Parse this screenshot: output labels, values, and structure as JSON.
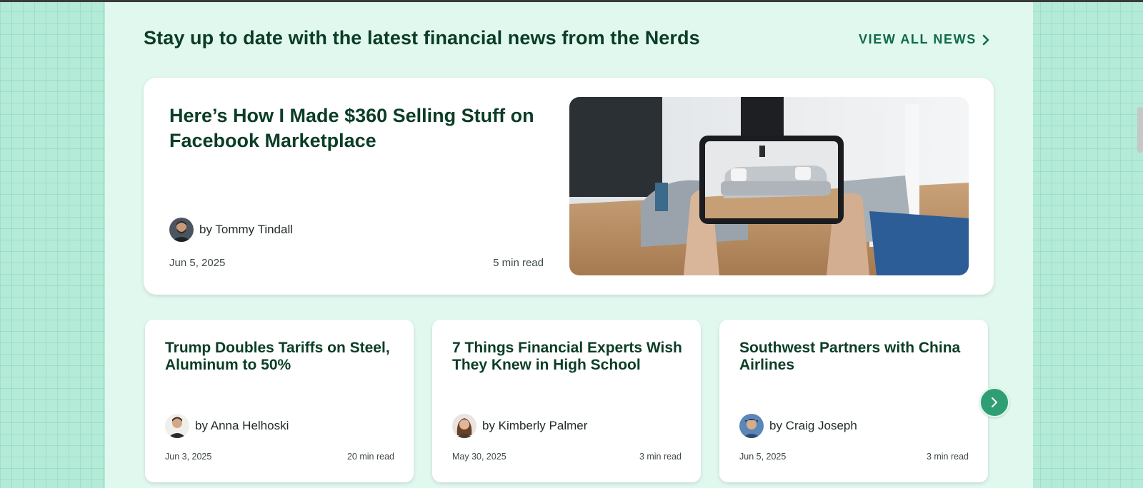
{
  "section": {
    "heading": "Stay up to date with the latest financial news from the Nerds",
    "view_all_label": "VIEW ALL NEWS"
  },
  "featured": {
    "title": "Here’s How I Made $360 Selling Stuff on Facebook Marketplace",
    "author": "by Tommy Tindall",
    "date": "Jun 5, 2025",
    "read_time": "5 min read"
  },
  "cards": [
    {
      "title": "Trump Doubles Tariffs on Steel, Aluminum to 50%",
      "author": "by Anna Helhoski",
      "date": "Jun 3, 2025",
      "read_time": "20 min read"
    },
    {
      "title": "7 Things Financial Experts Wish They Knew in High School",
      "author": "by Kimberly Palmer",
      "date": "May 30, 2025",
      "read_time": "3 min read"
    },
    {
      "title": "Southwest Partners with China Airlines",
      "author": "by Craig Joseph",
      "date": "Jun 5, 2025",
      "read_time": "3 min read"
    }
  ],
  "icons": {
    "view_all": "chevron-right-icon",
    "next": "chevron-right-icon"
  },
  "colors": {
    "heading": "#0b3d26",
    "link": "#0f6b46",
    "accent": "#2f9e74",
    "panel": "#e1f8ef",
    "page_bg": "#b4ead8"
  }
}
